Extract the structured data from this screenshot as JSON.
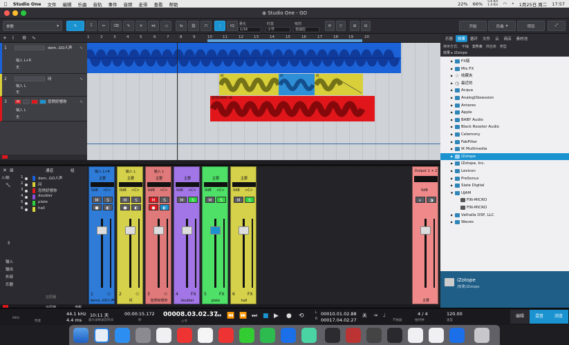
{
  "menubar": {
    "app_name": "Studio One",
    "items": [
      "文件",
      "编辑",
      "乐曲",
      "音轨",
      "事件",
      "音频",
      "走带",
      "查看",
      "帮助"
    ],
    "status": {
      "battery": "22%",
      "cpu": "66%",
      "network": "5.6 K/s\n1.4 K/s",
      "date": "1月25日 周二",
      "time": "17:57"
    }
  },
  "window": {
    "title": "Studio One - GO"
  },
  "toolbar": {
    "inspector_label": "参数",
    "quantize_label": "量化",
    "quantize_value": "1/16",
    "timebase_label": "时基",
    "timebase_value": "小节",
    "snap_label": "吸附",
    "snap_value": "自适应",
    "start_label": "开始",
    "song_label": "乐曲",
    "project_label": "项目"
  },
  "ruler": {
    "bars": [
      "1",
      "2",
      "3",
      "4",
      "5",
      "6",
      "7",
      "8",
      "9",
      "10",
      "11",
      "12",
      "13",
      "14",
      "15",
      "16",
      "17",
      "18",
      "19",
      "20"
    ]
  },
  "tracks": [
    {
      "num": "1",
      "name": "dem..GO人声",
      "input": "输入 L+R",
      "output": "无"
    },
    {
      "num": "2",
      "name": "问",
      "input": "输入 L",
      "output": "无"
    },
    {
      "num": "3",
      "name": "忽然好想你",
      "input": "输入 L",
      "output": "无",
      "record": "M"
    }
  ],
  "clips": [
    {
      "name": "问",
      "color": "#d8cf3a"
    },
    {
      "name": "问",
      "color": "#2e8fd6"
    },
    {
      "name": "问",
      "color": "#d8cf3a"
    },
    {
      "name": "忽然好想你-18",
      "color": "#e0161b"
    }
  ],
  "mixer_list": {
    "header_channels": "通道",
    "header_groups": "组",
    "input_label": "输入 L",
    "input_sub": "入/输",
    "side_labels": [
      "输入",
      "输出",
      "外部",
      "乐器"
    ],
    "filter_label": "还原器",
    "rows": [
      {
        "num": "1",
        "name": "dem..GO人声",
        "color": "#1b62d8"
      },
      {
        "num": "2",
        "name": "问",
        "color": "#d8cf3a"
      },
      {
        "num": "3",
        "name": "忽然好想你",
        "color": "#e0161b"
      },
      {
        "num": "4",
        "name": "doubler",
        "color": "#8c4fd8"
      },
      {
        "num": "5",
        "name": "plate",
        "color": "#2fd23f"
      },
      {
        "num": "6",
        "name": "hall",
        "color": "#d8d83a"
      }
    ]
  },
  "channels": [
    {
      "input": "输入 L+R",
      "bus": "主要",
      "gain": "0dB",
      "pan": "<C>",
      "num": "1",
      "name": "demo..GO人声",
      "color": "#2e7bd8"
    },
    {
      "input": "输入 L",
      "bus": "主要",
      "gain": "0dB",
      "pan": "<C>",
      "num": "2",
      "name": "问",
      "color": "#d6d14b"
    },
    {
      "input": "输入 L",
      "bus": "主要",
      "gain": "0dB",
      "pan": "<C>",
      "num": "3",
      "name": "忽然好想你",
      "color": "#e07a7a"
    },
    {
      "input": "",
      "bus": "主要",
      "gain": "0dB",
      "pan": "<C>",
      "num": "4",
      "name": "doubler",
      "color": "#a276e6"
    },
    {
      "input": "",
      "bus": "主要",
      "gain": "0dB",
      "pan": "<C>",
      "num": "5",
      "name": "plate",
      "color": "#4fe068"
    },
    {
      "input": "",
      "bus": "主要",
      "gain": "0dB",
      "pan": "<C>",
      "num": "6",
      "name": "hall",
      "color": "#d6d14b"
    }
  ],
  "master": {
    "output": "Output 1 + 2",
    "gain": "0dB",
    "name": "主要",
    "color": "#f08a8a"
  },
  "mixer_bottom": {
    "tracks_label": "轨道",
    "list_label": "还原器",
    "routing_label": "选程"
  },
  "browser": {
    "tabs": [
      "乐器",
      "效果",
      "循环",
      "文件",
      "云",
      "商店",
      "素材池"
    ],
    "sort_label": "排序方式:",
    "sort_options": [
      "平铺",
      "文件夹",
      "供应商",
      "类型"
    ],
    "path": "效果 ▸ iZotope",
    "items": [
      "FX链",
      "Mix FX",
      "收藏夹",
      "最近的",
      "Acqua",
      "AnalogObsession",
      "Antares",
      "Apple",
      "BABY Audio",
      "Black Rooster Audio",
      "Celemony",
      "FabFilter",
      "IK Multimedia",
      "iZotope",
      "iZotope, Inc.",
      "Lexicon",
      "PreSonus",
      "Slate Digital",
      "UJAM",
      "FIN-MICRO",
      "FIN-MICRO",
      "Valhalla DSP, LLC",
      "Waves"
    ],
    "selected_index": 13,
    "footer_name": "iZotope",
    "footer_path": "/效果/iZotope"
  },
  "transport": {
    "midi_label": "MIDI",
    "perf_label": "性能",
    "sample_rate": "44.1 kHz",
    "latency": "4.4 ms",
    "record_time": "10:11 天",
    "record_label": "最大录制录音时间",
    "seconds": "00:00:15.172",
    "seconds_label": "秒",
    "bars": "00008.03.02.37",
    "bars_label": "小节",
    "loop_l": "00010.01.02.88",
    "loop_r": "00017.04.02.27",
    "off_label": "关",
    "sync_label": "节拍器",
    "signature": "4 / 4",
    "signature_label": "拍时钟",
    "tempo": "120.00",
    "tempo_label": "速度",
    "edit_label": "编辑",
    "mix_label": "混音",
    "browse_label": "浏览"
  }
}
